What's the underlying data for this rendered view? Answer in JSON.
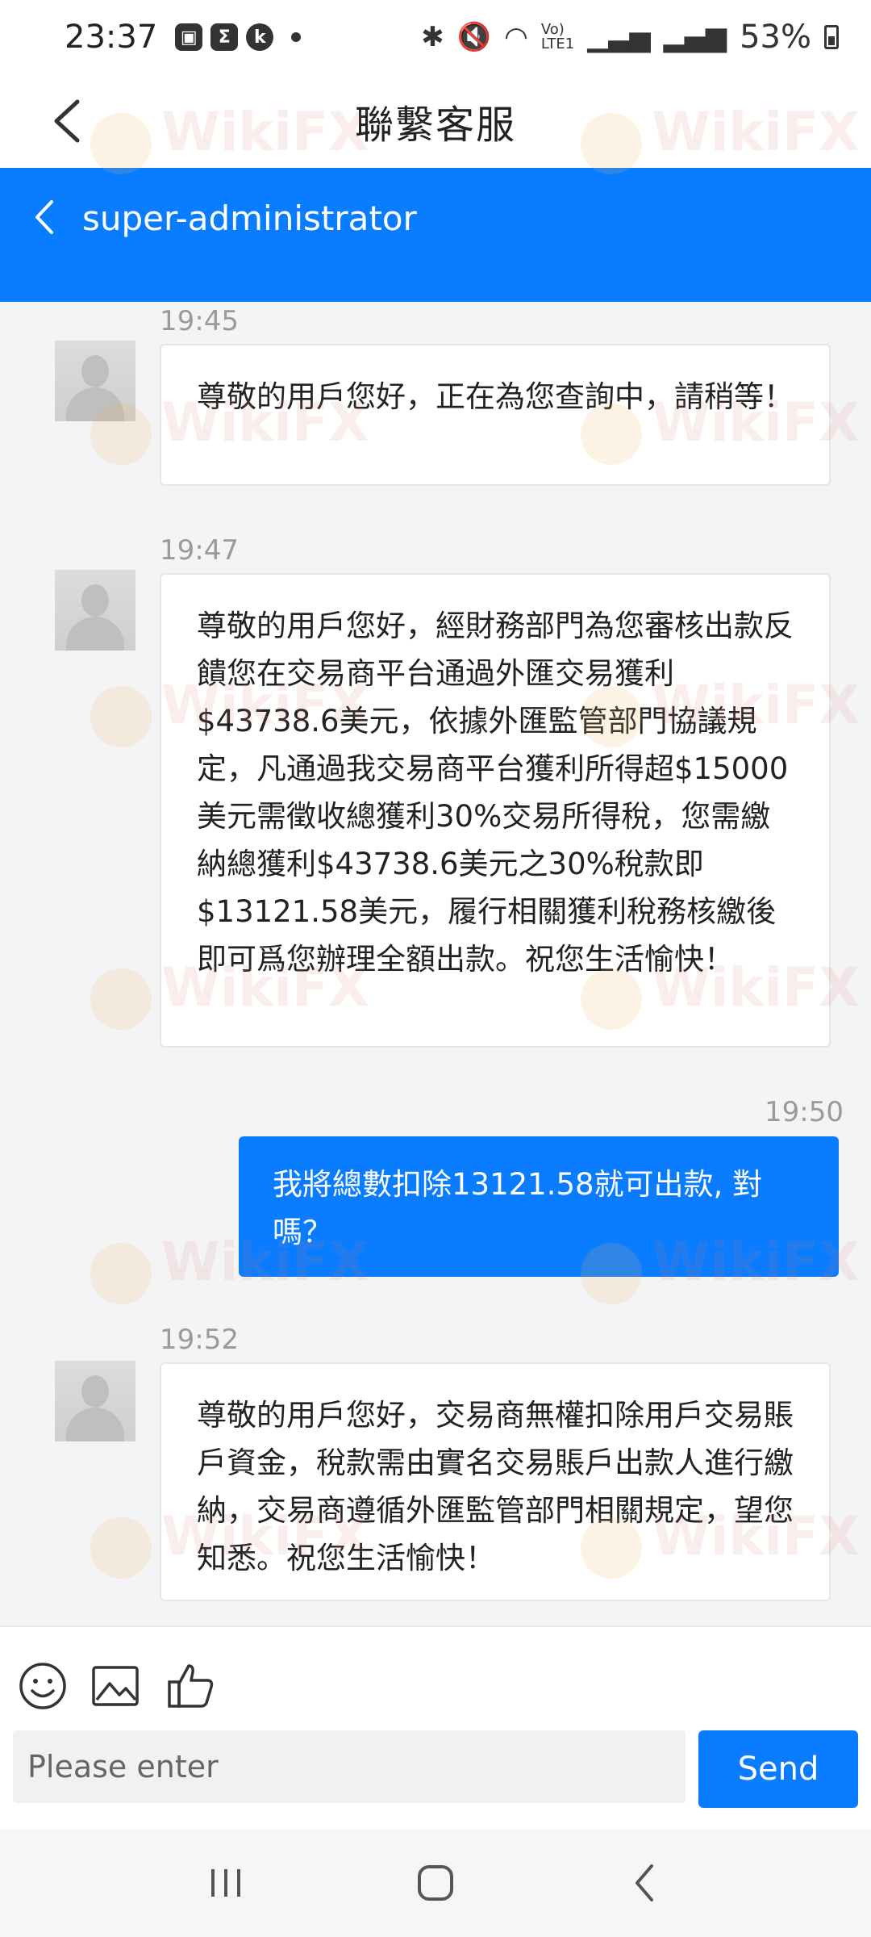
{
  "status_bar": {
    "time": "23:37",
    "left_icons": [
      "gallery-icon",
      "sigma-icon",
      "k-icon"
    ],
    "right_icons": [
      "bluetooth-icon",
      "mute-icon",
      "wifi-icon",
      "volte-icon",
      "signal-icon",
      "signal-r-icon"
    ],
    "battery": "53%"
  },
  "header": {
    "title": "聯繫客服"
  },
  "chat_header": {
    "name": "super-administrator"
  },
  "messages": [
    {
      "time": "19:45",
      "from": "agent",
      "text": "尊敬的用戶您好，正在為您查詢中，請稍等！"
    },
    {
      "time": "19:47",
      "from": "agent",
      "text": "尊敬的用戶您好，經財務部門為您審核出款反饋您在交易商平台通過外匯交易獲利$43738.6美元，依據外匯監管部門協議規定，凡通過我交易商平台獲利所得超$15000美元需徵收總獲利30%交易所得稅，您需繳納總獲利$43738.6美元之30%稅款即$13121.58美元，履行相關獲利稅務核繳後即可爲您辦理全額出款。祝您生活愉快！"
    },
    {
      "time": "19:50",
      "from": "me",
      "text": "我將總數扣除13121.58就可出款, 對嗎？"
    },
    {
      "time": "19:52",
      "from": "agent",
      "text": "尊敬的用戶您好，交易商無權扣除用戶交易賬戶資金，稅款需由實名交易賬戶出款人進行繳納，交易商遵循外匯監管部門相關規定，望您知悉。祝您生活愉快！"
    }
  ],
  "composer": {
    "placeholder": "Please enter",
    "send_label": "Send",
    "tools": [
      "emoji-icon",
      "image-icon",
      "thumbs-up-icon"
    ]
  },
  "watermark": "WikiFX",
  "colors": {
    "accent": "#0a7cff",
    "background": "#f4f4f6"
  }
}
